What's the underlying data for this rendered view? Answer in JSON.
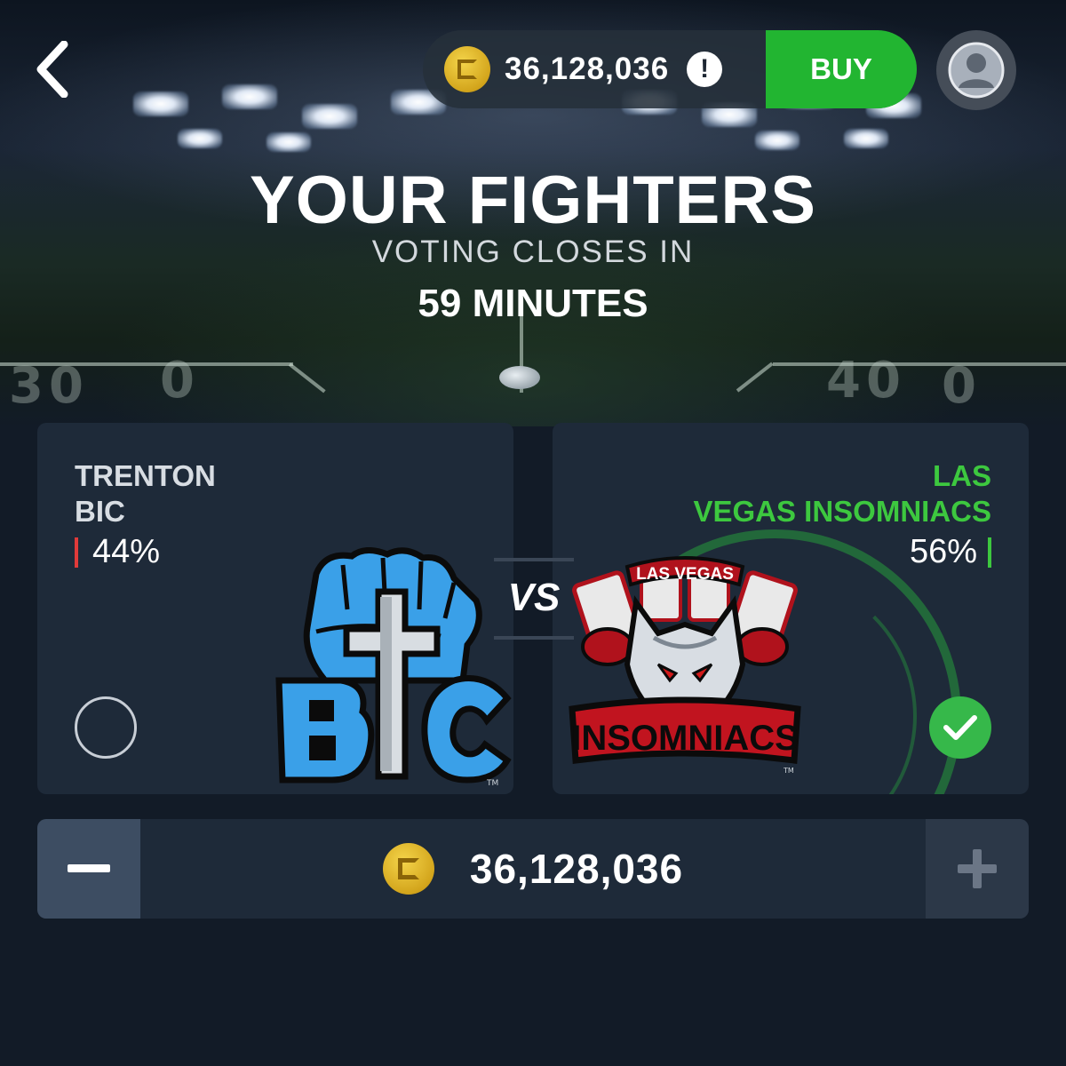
{
  "header": {
    "balance": "36,128,036",
    "buy_label": "BUY",
    "alert_symbol": "!",
    "title": "YOUR FIGHTERS",
    "voting_label": "VOTING CLOSES IN",
    "voting_time": "59 MINUTES"
  },
  "matchup": {
    "vs_label": "VS",
    "left_team": {
      "name_line1": "TRENTON",
      "name_line2": "BIC",
      "percent": "44%",
      "bar_color": "#e03a3a",
      "selected": false
    },
    "right_team": {
      "name_line1": "LAS",
      "name_line2": "VEGAS INSOMNIACS",
      "percent": "56%",
      "bar_color": "#3dc83f",
      "selected": true,
      "accent_color": "#3dc83f"
    }
  },
  "wager": {
    "amount": "36,128,036",
    "minus_label": "−",
    "plus_label": "+"
  },
  "icons": {
    "back": "chevron-left-icon",
    "profile": "user-avatar-icon",
    "coin": "coin-icon",
    "check": "checkmark-icon"
  },
  "logos": {
    "left_logo_text": "BIC",
    "right_logo_top": "LAS VEGAS",
    "right_logo_bottom": "INSOMNIACS"
  }
}
